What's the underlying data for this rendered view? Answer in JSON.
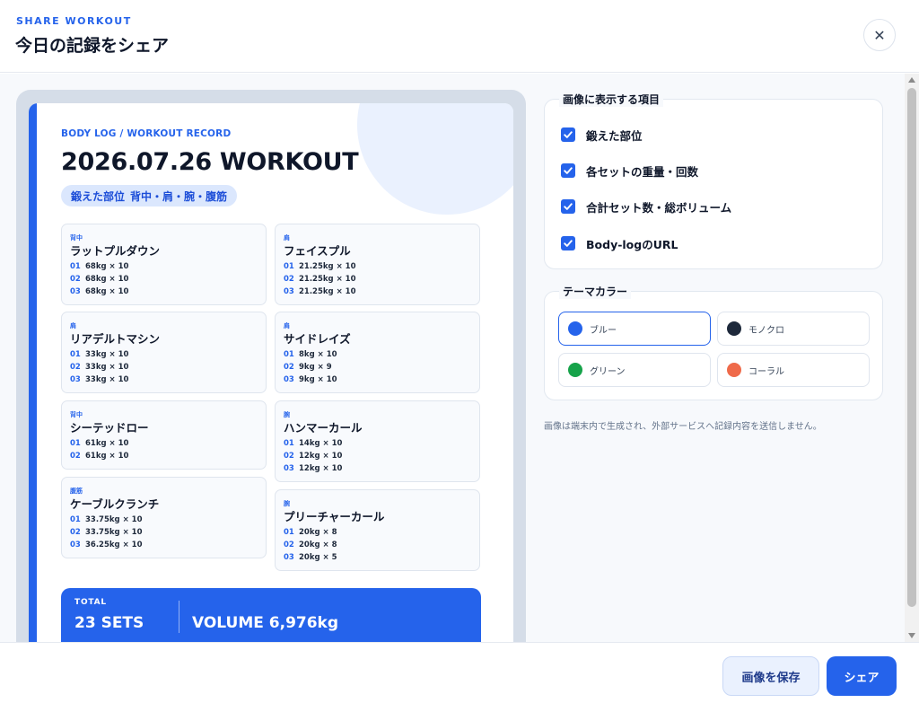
{
  "header": {
    "eyebrow": "SHARE WORKOUT",
    "title": "今日の記録をシェア",
    "close_icon": "close-icon"
  },
  "card": {
    "brand": "BODY LOG / WORKOUT RECORD",
    "title": "2026.07.26 WORKOUT",
    "parts_label": "鍛えた部位",
    "parts_value": "背中・肩・腕・腹筋",
    "exercises": [
      {
        "category": "背中",
        "name": "ラットプルダウン",
        "sets": [
          {
            "no": "01",
            "val": "68kg × 10"
          },
          {
            "no": "02",
            "val": "68kg × 10"
          },
          {
            "no": "03",
            "val": "68kg × 10"
          }
        ]
      },
      {
        "category": "肩",
        "name": "フェイスプル",
        "sets": [
          {
            "no": "01",
            "val": "21.25kg × 10"
          },
          {
            "no": "02",
            "val": "21.25kg × 10"
          },
          {
            "no": "03",
            "val": "21.25kg × 10"
          }
        ]
      },
      {
        "category": "肩",
        "name": "リアデルトマシン",
        "sets": [
          {
            "no": "01",
            "val": "33kg × 10"
          },
          {
            "no": "02",
            "val": "33kg × 10"
          },
          {
            "no": "03",
            "val": "33kg × 10"
          }
        ]
      },
      {
        "category": "肩",
        "name": "サイドレイズ",
        "sets": [
          {
            "no": "01",
            "val": "8kg × 10"
          },
          {
            "no": "02",
            "val": "9kg × 9"
          },
          {
            "no": "03",
            "val": "9kg × 10"
          }
        ]
      },
      {
        "category": "背中",
        "name": "シーテッドロー",
        "sets": [
          {
            "no": "01",
            "val": "61kg × 10"
          },
          {
            "no": "02",
            "val": "61kg × 10"
          }
        ]
      },
      {
        "category": "腕",
        "name": "ハンマーカール",
        "sets": [
          {
            "no": "01",
            "val": "14kg × 10"
          },
          {
            "no": "02",
            "val": "12kg × 10"
          },
          {
            "no": "03",
            "val": "12kg × 10"
          }
        ]
      },
      {
        "category": "腹筋",
        "name": "ケーブルクランチ",
        "sets": [
          {
            "no": "01",
            "val": "33.75kg × 10"
          },
          {
            "no": "02",
            "val": "33.75kg × 10"
          },
          {
            "no": "03",
            "val": "36.25kg × 10"
          }
        ]
      },
      {
        "category": "腕",
        "name": "プリーチャーカール",
        "sets": [
          {
            "no": "01",
            "val": "20kg × 8"
          },
          {
            "no": "02",
            "val": "20kg × 8"
          },
          {
            "no": "03",
            "val": "20kg × 5"
          }
        ]
      }
    ],
    "total": {
      "label": "TOTAL",
      "sets": "23 SETS",
      "volume": "VOLUME 6,976kg"
    }
  },
  "display_options": {
    "legend": "画像に表示する項目",
    "items": [
      {
        "label": "鍛えた部位",
        "checked": true
      },
      {
        "label": "各セットの重量・回数",
        "checked": true
      },
      {
        "label": "合計セット数・総ボリューム",
        "checked": true
      },
      {
        "label": "Body-logのURL",
        "checked": true
      }
    ]
  },
  "theme": {
    "legend": "テーマカラー",
    "options": [
      {
        "label": "ブルー",
        "color": "#2563eb",
        "selected": true
      },
      {
        "label": "モノクロ",
        "color": "#1e293b",
        "selected": false
      },
      {
        "label": "グリーン",
        "color": "#16a34a",
        "selected": false
      },
      {
        "label": "コーラル",
        "color": "#ef6a4a",
        "selected": false
      }
    ]
  },
  "note": "画像は端末内で生成され、外部サービスへ記録内容を送信しません。",
  "footer": {
    "save_label": "画像を保存",
    "share_label": "シェア"
  }
}
